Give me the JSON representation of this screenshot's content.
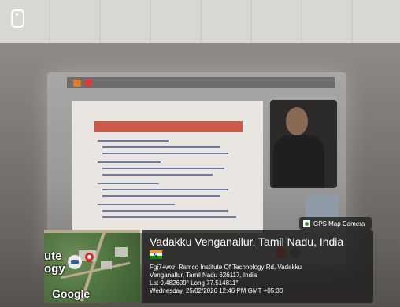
{
  "overlay": {
    "chip_label": "GPS Map Camera",
    "location_title": "Vadakku Venganallur, Tamil Nadu, India",
    "address_line1": "Fgj7+wxr, Ramco Institute Of Technology Rd, Vadakku",
    "address_line2": "Venganallur, Tamil Nadu 626117, India",
    "coordinates": "Lat 9.482609° Long 77.514811°",
    "datetime": "Wednesday, 25/02/2026 12:46 PM GMT +05:30",
    "map_text_1": "ute",
    "map_text_2": "ogy",
    "map_text_3": "Google"
  },
  "colors": {
    "overlay_bg": "#1e1e1e",
    "slide_header": "#c95b4a",
    "pin": "#d93025",
    "flag_saffron": "#f29933",
    "flag_green": "#138808"
  }
}
